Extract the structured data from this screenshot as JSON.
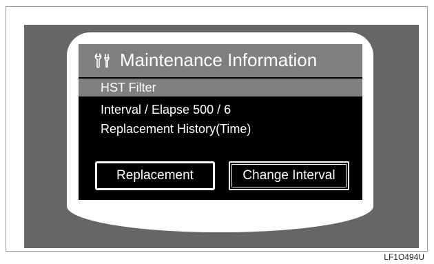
{
  "screen": {
    "title": "Maintenance Information",
    "title_icon": "wrench-icon",
    "rows": {
      "selected_item": "HST Filter",
      "interval_elapse": "Interval / Elapse  500 / 6",
      "replacement_history": "Replacement History(Time)"
    },
    "buttons": {
      "replacement_label": "Replacement",
      "change_interval_label": "Change Interval"
    }
  },
  "caption": "LF1O494U",
  "colors": {
    "display_background": "#000000",
    "highlight_bar": "#7f7f7f",
    "surround": "#666666",
    "text": "#ffffff"
  }
}
